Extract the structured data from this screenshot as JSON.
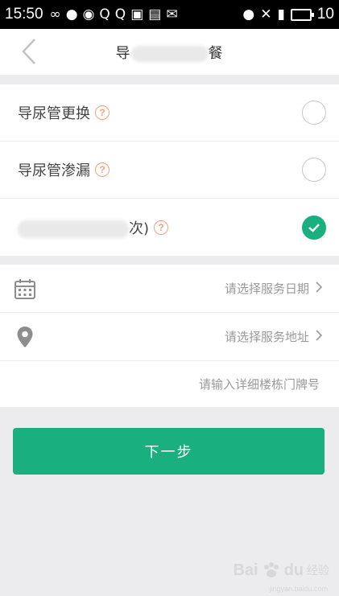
{
  "status_bar": {
    "time": "15:50",
    "battery_level": "10",
    "icons": [
      "infinity-icon",
      "chat-icon",
      "app-icon",
      "q-icon",
      "q-icon",
      "image-icon",
      "keyboard-icon",
      "mail-icon",
      "bug-icon",
      "mute-icon",
      "signal-icon"
    ]
  },
  "header": {
    "title_visible_start": "导",
    "title_visible_end": "餐"
  },
  "options": [
    {
      "label": "导尿管更换",
      "checked": false
    },
    {
      "label": "导尿管渗漏",
      "checked": false
    },
    {
      "label_visible_end": "次)",
      "checked": true
    }
  ],
  "service": {
    "date_placeholder": "请选择服务日期",
    "address_placeholder": "请选择服务地址",
    "detail_placeholder": "请输入详细楼栋门牌号"
  },
  "next_button": "下一步",
  "watermark": {
    "brand": "Bai",
    "du": "du",
    "tail": "经验",
    "sub": "jingyan.baidu.com"
  },
  "colors": {
    "accent": "#1aaf7e",
    "help": "#f3a17a",
    "background": "#ececef"
  }
}
